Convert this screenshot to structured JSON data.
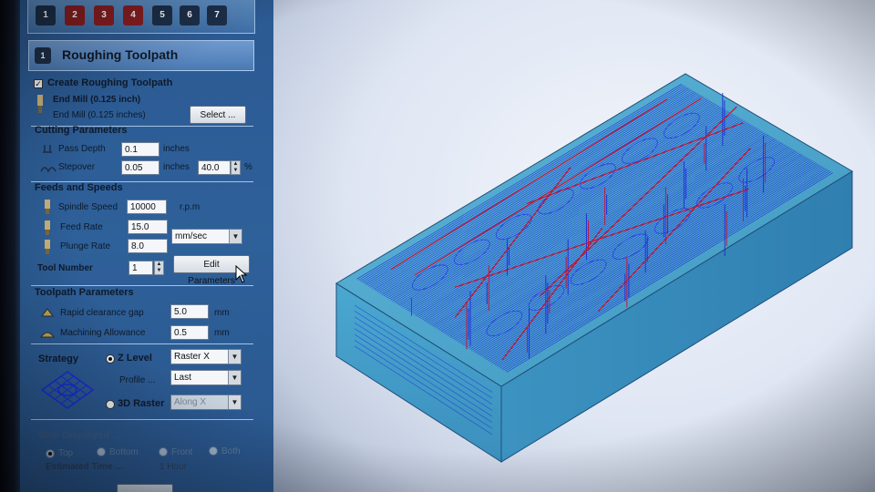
{
  "toolbar": {
    "icons": [
      "1",
      "2",
      "3",
      "4",
      "5",
      "6",
      "7"
    ]
  },
  "header": {
    "title": "Roughing Toolpath",
    "icon": "1"
  },
  "create": {
    "label": "Create Roughing Toolpath",
    "checked": true
  },
  "tool": {
    "name": "End Mill (0.125 inch)",
    "desc": "End Mill (0.125 inches)",
    "select_label": "Select ..."
  },
  "cutting": {
    "heading": "Cutting Parameters",
    "pass_depth_label": "Pass Depth",
    "pass_depth_value": "0.1",
    "pass_depth_unit": "inches",
    "stepover_label": "Stepover",
    "stepover_value": "0.05",
    "stepover_unit": "inches",
    "stepover_pct": "40.0",
    "pct_symbol": "%"
  },
  "feeds": {
    "heading": "Feeds and Speeds",
    "spindle_label": "Spindle Speed",
    "spindle_value": "10000",
    "spindle_unit": "r.p.m",
    "feed_label": "Feed Rate",
    "feed_value": "15.0",
    "plunge_label": "Plunge Rate",
    "plunge_value": "8.0",
    "rate_unit": "mm/sec",
    "tool_number_label": "Tool Number",
    "tool_number_value": "1",
    "edit_params_label": "Edit Parameters"
  },
  "toolpath": {
    "heading": "Toolpath Parameters",
    "rapid_label": "Rapid clearance gap",
    "rapid_value": "5.0",
    "rapid_unit": "mm",
    "allowance_label": "Machining Allowance",
    "allowance_value": "0.5",
    "allowance_unit": "mm"
  },
  "strategy": {
    "label": "Strategy",
    "zlevel_label": "Z Level",
    "zlevel_option": "Raster X",
    "profile_label": "Profile ...",
    "profile_option": "Last",
    "raster3d_label": "3D Raster",
    "raster3d_option": "Along X"
  },
  "side": {
    "heading": "Side Displayed ...",
    "options": [
      "Top",
      "Bottom",
      "Front",
      "Both"
    ],
    "selected": "Top",
    "est_label": "Estimated Time ...",
    "est_value": "1 Hour"
  },
  "colors": {
    "panel": "#2e6099",
    "block_fill": "#4aa3c9",
    "toolpath_blue": "#1a2bd8",
    "toolpath_red": "#c8102e"
  }
}
